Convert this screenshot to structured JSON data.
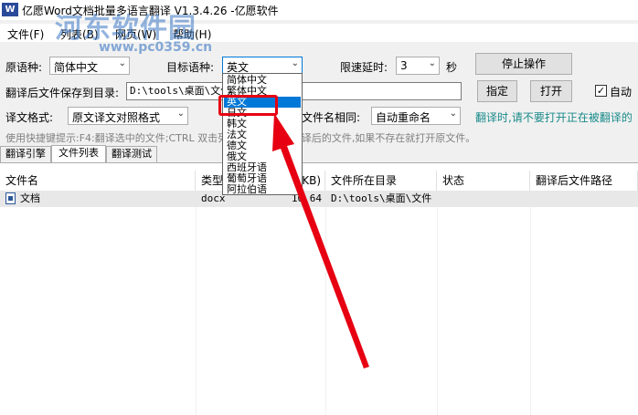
{
  "window": {
    "title": "亿愿Word文档批量多语言翻译 V1.3.4.26 -亿愿软件",
    "icon": "app-icon"
  },
  "menu": [
    "文件(F)",
    "列表(B)",
    "网页(W)",
    "帮助(H)"
  ],
  "watermark": {
    "text": "河东软件园",
    "url": "www.pc0359.cn"
  },
  "toolbar": {
    "source_lang_label": "原语种:",
    "source_lang_value": "简体中文",
    "target_lang_label": "目标语种:",
    "target_lang_value": "英文",
    "delay_label": "限速延时:",
    "delay_value": "3",
    "delay_unit": "秒",
    "stop_button": "停止操作",
    "save_dir_label": "翻译后文件保存到目录:",
    "save_dir_value": "D:\\tools\\桌面\\文件",
    "specify_button": "指定",
    "open_button": "打开",
    "auto_checkbox_label": "自动",
    "auto_checked": true,
    "format_label": "译文格式:",
    "format_value": "原文译文对照格式",
    "same_name_label": "文件名相同:",
    "same_name_value": "自动重命名",
    "warning": "翻译时,请不要打开正在被翻译的",
    "hint": "使用快捷键提示:F4:翻译选中的文件;CTRL    双击列表某记录:打开翻译后的文件,如果不存在就打开原文件。"
  },
  "target_dropdown_options": [
    "简体中文",
    "繁体中文",
    "英文",
    "日文",
    "韩文",
    "法文",
    "德文",
    "俄文",
    "西班牙语",
    "葡萄牙语",
    "阿拉伯语"
  ],
  "target_dropdown_selected_index": 2,
  "tabs": [
    "翻译引擎",
    "文件列表",
    "翻译测试"
  ],
  "active_tab_index": 1,
  "table": {
    "columns": [
      "文件名",
      "类型",
      "(KB)",
      "文件所在目录",
      "状态",
      "翻译后文件路径"
    ],
    "rows": [
      {
        "name": "文档",
        "type": "docx",
        "size": "10.64",
        "dir": "D:\\tools\\桌面\\文件",
        "status": "",
        "out": ""
      }
    ]
  },
  "annotation_colors": {
    "highlight": "#e60012",
    "selection": "#0078d7"
  }
}
